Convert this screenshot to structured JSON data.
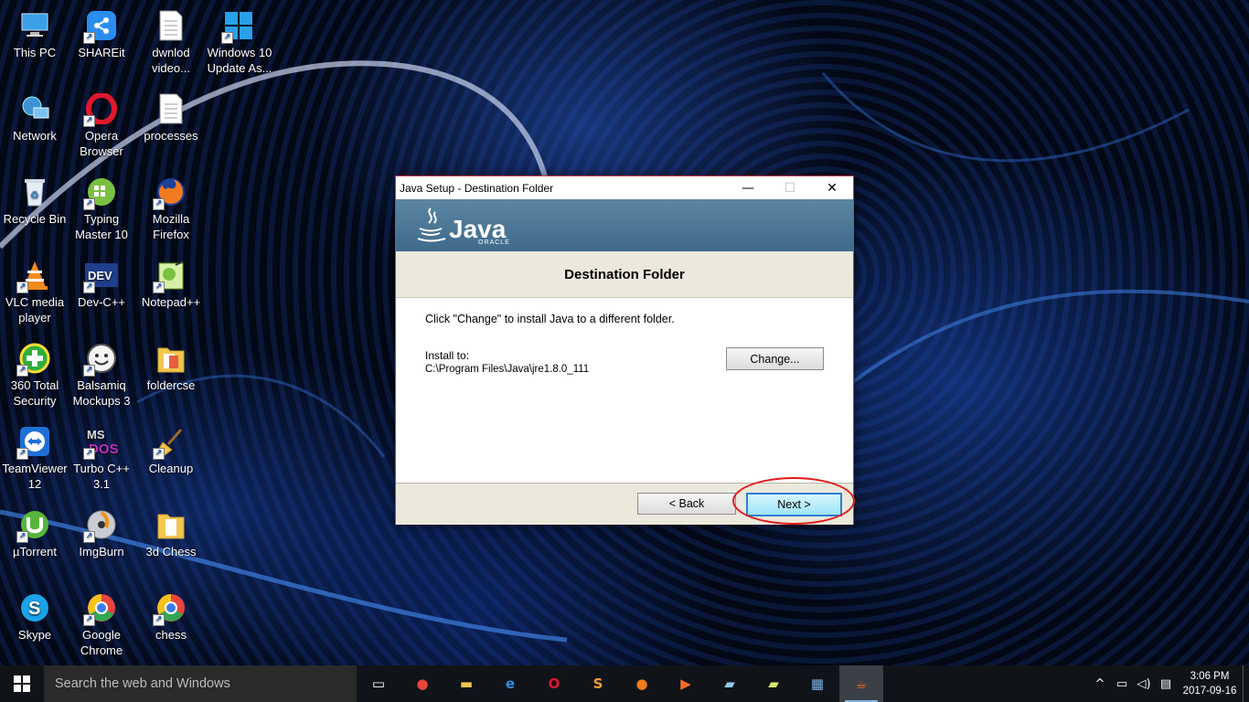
{
  "desktop_icons": [
    {
      "label": "This PC",
      "icon": "computer-icon"
    },
    {
      "label": "SHAREit",
      "icon": "shareit-icon"
    },
    {
      "label": "dwnlod video...",
      "icon": "text-file-icon"
    },
    {
      "label": "Windows 10 Update As...",
      "icon": "windows-logo-icon"
    },
    {
      "label": "Network",
      "icon": "network-icon"
    },
    {
      "label": "Opera Browser",
      "icon": "opera-icon"
    },
    {
      "label": "processes",
      "icon": "text-file-icon"
    },
    {
      "label": "Recycle Bin",
      "icon": "recycle-bin-icon"
    },
    {
      "label": "Typing Master 10",
      "icon": "typing-master-icon"
    },
    {
      "label": "Mozilla Firefox",
      "icon": "firefox-icon"
    },
    {
      "label": "VLC media player",
      "icon": "vlc-icon"
    },
    {
      "label": "Dev-C++",
      "icon": "devcpp-icon"
    },
    {
      "label": "Notepad++",
      "icon": "notepadpp-icon"
    },
    {
      "label": "360 Total Security",
      "icon": "360-security-icon"
    },
    {
      "label": "Balsamiq Mockups 3",
      "icon": "balsamiq-icon"
    },
    {
      "label": "foldercse",
      "icon": "folder-icon"
    },
    {
      "label": "TeamViewer 12",
      "icon": "teamviewer-icon"
    },
    {
      "label": "Turbo C++ 3.1",
      "icon": "turbo-cpp-icon"
    },
    {
      "label": "Cleanup",
      "icon": "broom-icon"
    },
    {
      "label": "µTorrent",
      "icon": "utorrent-icon"
    },
    {
      "label": "ImgBurn",
      "icon": "imgburn-icon"
    },
    {
      "label": "3d Chess",
      "icon": "folder-icon"
    },
    {
      "label": "Skype",
      "icon": "skype-icon"
    },
    {
      "label": "Google Chrome",
      "icon": "chrome-icon"
    },
    {
      "label": "chess",
      "icon": "chrome-icon"
    }
  ],
  "dialog": {
    "title": "Java Setup - Destination Folder",
    "minimize": "—",
    "maximize": "☐",
    "close": "✕",
    "brand": "Java",
    "brand_sub": "ORACLE",
    "heading": "Destination Folder",
    "instruction": "Click \"Change\" to install Java to a different folder.",
    "install_label": "Install to:",
    "install_path": "C:\\Program Files\\Java\\jre1.8.0_111",
    "change_button": "Change...",
    "back_button": "< Back",
    "next_button": "Next >"
  },
  "taskbar": {
    "search_placeholder": "Search the web and Windows",
    "apps": [
      {
        "name": "task-view-icon",
        "glyph": "▭",
        "color": "#ffffff"
      },
      {
        "name": "chrome-icon",
        "glyph": "●",
        "color": "#e8453c"
      },
      {
        "name": "file-explorer-icon",
        "glyph": "▬",
        "color": "#f3c650"
      },
      {
        "name": "edge-icon",
        "glyph": "e",
        "color": "#2f8fe6"
      },
      {
        "name": "opera-icon",
        "glyph": "O",
        "color": "#e0182d"
      },
      {
        "name": "sublime-icon",
        "glyph": "S",
        "color": "#f29d36"
      },
      {
        "name": "firefox-icon",
        "glyph": "●",
        "color": "#f07a1c"
      },
      {
        "name": "media-player-icon",
        "glyph": "▶",
        "color": "#f26b2a"
      },
      {
        "name": "notes-icon",
        "glyph": "▰",
        "color": "#8ec7ee"
      },
      {
        "name": "folder-icon",
        "glyph": "▰",
        "color": "#d9e86a"
      },
      {
        "name": "installer-icon",
        "glyph": "▦",
        "color": "#7fb0e0"
      },
      {
        "name": "java-setup-icon",
        "glyph": "☕",
        "color": "#e86a1c"
      }
    ],
    "time": "3:06 PM",
    "date": "2017-09-16"
  }
}
